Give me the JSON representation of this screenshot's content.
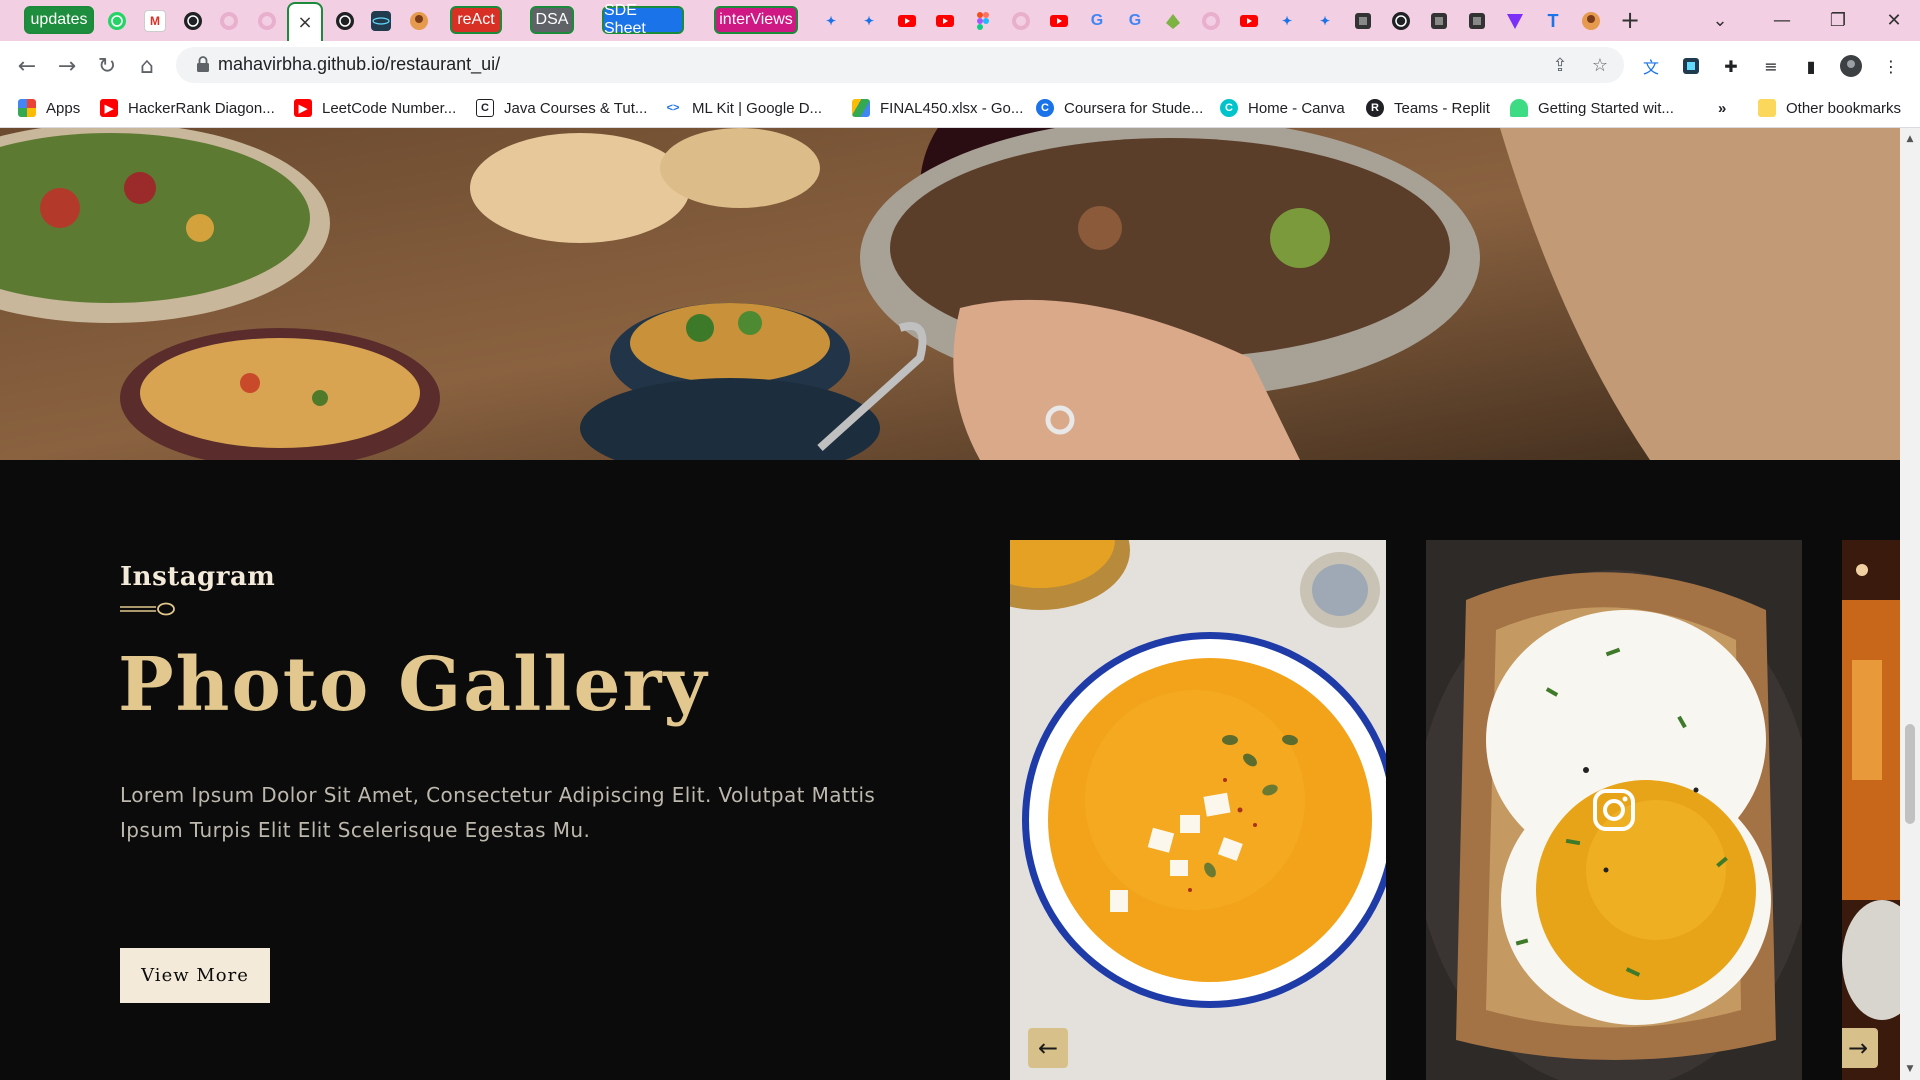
{
  "browser": {
    "tab_groups": [
      {
        "label": "updates",
        "color": "#1e8e3e"
      },
      {
        "label": "reAct",
        "color": "#d93025"
      },
      {
        "label": "DSA",
        "color": "#5f6368"
      },
      {
        "label": "SDE Sheet",
        "color": "#1a73e8"
      },
      {
        "label": "interViews",
        "color": "#d01884"
      }
    ],
    "active_tab_close": "×",
    "new_tab": "+",
    "url": "mahavirbha.github.io/restaurant_ui/",
    "window_controls": {
      "minimize": "—",
      "maximize": "❐",
      "close": "✕",
      "dropdown": "⌄"
    }
  },
  "bookmarks": {
    "items": [
      {
        "label": "Apps",
        "icon": "apps-grid-icon"
      },
      {
        "label": "HackerRank Diagon...",
        "icon": "youtube-icon"
      },
      {
        "label": "LeetCode Number...",
        "icon": "youtube-icon"
      },
      {
        "label": "Java Courses & Tut...",
        "icon": "c-icon"
      },
      {
        "label": "ML Kit | Google D...",
        "icon": "code-icon"
      },
      {
        "label": "FINAL450.xlsx - Go...",
        "icon": "drive-icon"
      },
      {
        "label": "Coursera for Stude...",
        "icon": "coursera-icon"
      },
      {
        "label": "Home - Canva",
        "icon": "canva-icon"
      },
      {
        "label": "Teams - Replit",
        "icon": "replit-icon"
      },
      {
        "label": "Getting Started wit...",
        "icon": "android-icon"
      }
    ],
    "overflow": "»",
    "other": "Other bookmarks"
  },
  "gallery": {
    "eyebrow": "Instagram",
    "title": "Photo Gallery",
    "description": "Lorem Ipsum Dolor Sit Amet, Consectetur Adipiscing Elit. Volutpat Mattis Ipsum Turpis Elit Elit Scelerisque Egestas Mu.",
    "button": "View More",
    "prev_arrow": "←",
    "next_arrow": "→"
  },
  "colors": {
    "gold": "#e2c88e",
    "cream": "#f3ead9",
    "bg": "#0b0b0b",
    "arrow_bg": "#d8c08b"
  }
}
